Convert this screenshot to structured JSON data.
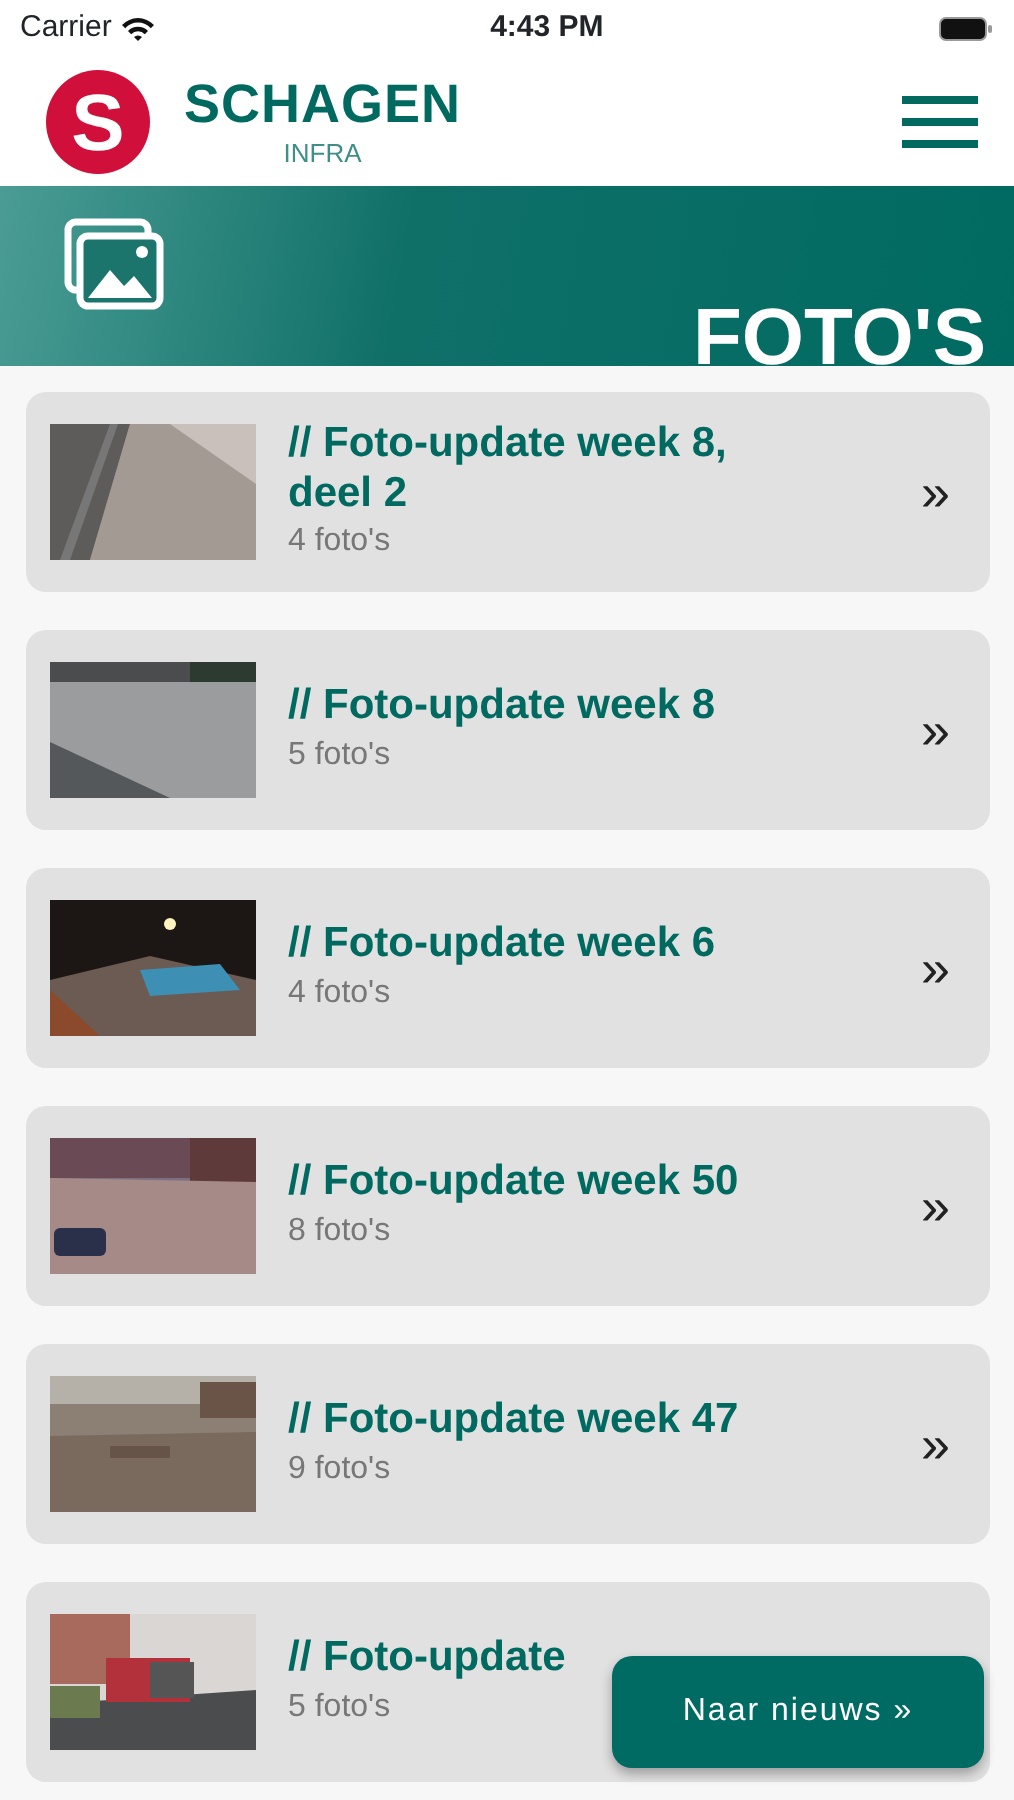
{
  "status_bar": {
    "carrier": "Carrier",
    "time": "4:43 PM"
  },
  "header": {
    "brand": "SCHAGEN",
    "sub": "INFRA",
    "logo_letter": "S"
  },
  "banner": {
    "title": "FOTO'S"
  },
  "albums": [
    {
      "title": "// Foto-update week 8, deel 2",
      "count": "4 foto's",
      "arrow": "»"
    },
    {
      "title": "// Foto-update week 8",
      "count": "5 foto's",
      "arrow": "»"
    },
    {
      "title": "// Foto-update week 6",
      "count": "4 foto's",
      "arrow": "»"
    },
    {
      "title": "// Foto-update week 50",
      "count": "8 foto's",
      "arrow": "»"
    },
    {
      "title": "// Foto-update week 47",
      "count": "9 foto's",
      "arrow": "»"
    },
    {
      "title": "// Foto-update",
      "count": "5 foto's"
    }
  ],
  "fab": {
    "label": "Naar nieuws »"
  }
}
